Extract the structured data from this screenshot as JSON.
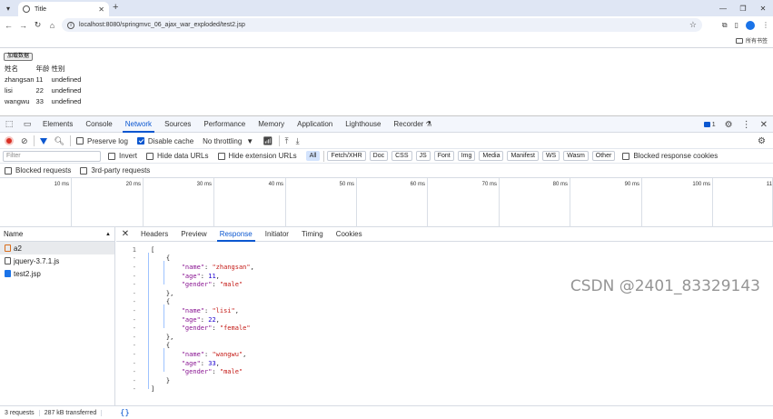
{
  "browser": {
    "tab_title": "Title",
    "url": "localhost:8080/springmvc_06_ajax_war_exploded/test2.jsp",
    "all_bookmarks": "所有书签"
  },
  "page": {
    "load_button": "加载数据",
    "table_headers": [
      "姓名",
      "年龄",
      "性别"
    ],
    "rows": [
      [
        "zhangsan",
        "11",
        "undefined"
      ],
      [
        "lisi",
        "22",
        "undefined"
      ],
      [
        "wangwu",
        "33",
        "undefined"
      ]
    ]
  },
  "devtools": {
    "tabs": [
      "Elements",
      "Console",
      "Network",
      "Sources",
      "Performance",
      "Memory",
      "Application",
      "Lighthouse",
      "Recorder"
    ],
    "active_tab": "Network",
    "issues_count": "1",
    "toolbar": {
      "preserve_log": "Preserve log",
      "disable_cache": "Disable cache",
      "throttling": "No throttling"
    },
    "filter": {
      "placeholder": "Filter",
      "invert": "Invert",
      "hide_data_urls": "Hide data URLs",
      "hide_extension_urls": "Hide extension URLs",
      "types": [
        "All",
        "Fetch/XHR",
        "Doc",
        "CSS",
        "JS",
        "Font",
        "Img",
        "Media",
        "Manifest",
        "WS",
        "Wasm",
        "Other"
      ],
      "blocked_cookies": "Blocked response cookies",
      "blocked_requests": "Blocked requests",
      "third_party": "3rd-party requests"
    },
    "timeline_ticks": [
      "10 ms",
      "20 ms",
      "30 ms",
      "40 ms",
      "50 ms",
      "60 ms",
      "70 ms",
      "80 ms",
      "90 ms",
      "100 ms",
      "11"
    ],
    "name_header": "Name",
    "requests": [
      {
        "name": "a2",
        "selected": true
      },
      {
        "name": "jquery-3.7.1.js",
        "selected": false
      },
      {
        "name": "test2.jsp",
        "selected": false
      }
    ],
    "detail_tabs": [
      "Headers",
      "Preview",
      "Response",
      "Initiator",
      "Timing",
      "Cookies"
    ],
    "active_detail_tab": "Response",
    "response_lines": [
      {
        "g": "1",
        "t": "["
      },
      {
        "g": "-",
        "t": "    {"
      },
      {
        "g": "-",
        "t": "        \"name\": \"zhangsan\","
      },
      {
        "g": "-",
        "t": "        \"age\": 11,"
      },
      {
        "g": "-",
        "t": "        \"gender\": \"male\""
      },
      {
        "g": "-",
        "t": "    },"
      },
      {
        "g": "-",
        "t": "    {"
      },
      {
        "g": "-",
        "t": "        \"name\": \"lisi\","
      },
      {
        "g": "-",
        "t": "        \"age\": 22,"
      },
      {
        "g": "-",
        "t": "        \"gender\": \"female\""
      },
      {
        "g": "-",
        "t": "    },"
      },
      {
        "g": "-",
        "t": "    {"
      },
      {
        "g": "-",
        "t": "        \"name\": \"wangwu\","
      },
      {
        "g": "-",
        "t": "        \"age\": 33,"
      },
      {
        "g": "-",
        "t": "        \"gender\": \"male\""
      },
      {
        "g": "-",
        "t": "    }"
      },
      {
        "g": "-",
        "t": "]"
      }
    ],
    "status": {
      "requests": "3 requests",
      "transferred": "287 kB transferred",
      "pretty": "{}"
    }
  },
  "watermark": "CSDN @2401_83329143",
  "colors": {
    "accent": "#0b57d0",
    "record": "#d93025"
  }
}
